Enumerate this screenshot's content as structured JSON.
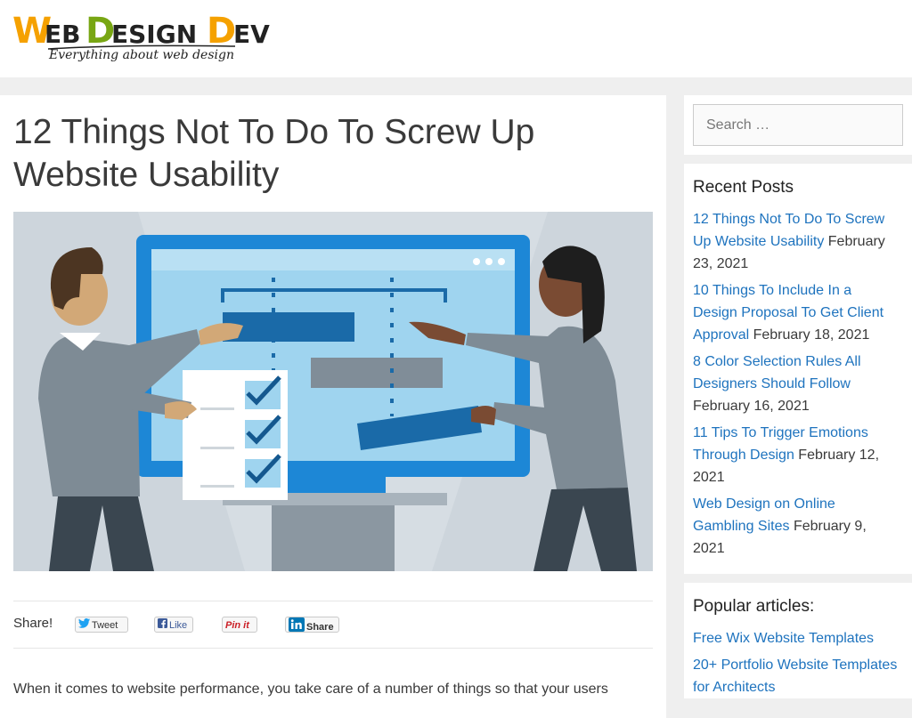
{
  "header": {
    "logo_text": "WebDesignDev",
    "tagline": "Everything about web design"
  },
  "article": {
    "title": "12 Things Not To Do To Screw Up Website Usability",
    "share_label": "Share!",
    "share_buttons": {
      "tweet": "Tweet",
      "like": "Like",
      "pin": "Pin it",
      "linkedin": "Share"
    },
    "intro": "When it comes to website performance, you take care of a number of things so that your users"
  },
  "sidebar": {
    "search": {
      "placeholder": "Search …"
    },
    "recent_posts": {
      "title": "Recent Posts",
      "items": [
        {
          "label": "12 Things Not To Do To Screw Up Website Usability",
          "date": "February 23, 2021"
        },
        {
          "label": "10 Things To Include In a Design Proposal To Get Client Approval",
          "date": "February 18, 2021"
        },
        {
          "label": "8 Color Selection Rules All Designers Should Follow",
          "date": "February 16, 2021"
        },
        {
          "label": "11 Tips To Trigger Emotions Through Design",
          "date": "February 12, 2021"
        },
        {
          "label": "Web Design on Online Gambling Sites",
          "date": "February 9, 2021"
        }
      ]
    },
    "popular": {
      "title": "Popular articles:",
      "items": [
        {
          "label": "Free Wix Website Templates"
        },
        {
          "label": "20+ Portfolio Website Templates for Architects"
        }
      ]
    }
  },
  "colors": {
    "link": "#1e73be",
    "page_bg": "#efefef",
    "hero_bg": "#d6dde3",
    "monitor": "#1d87d6",
    "screen": "#9fd4ef"
  }
}
